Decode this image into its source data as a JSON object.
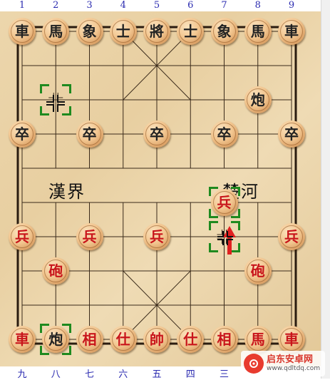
{
  "top_files": [
    "1",
    "2",
    "3",
    "4",
    "5",
    "6",
    "7",
    "8",
    "9"
  ],
  "bottom_files": [
    "九",
    "八",
    "七",
    "六",
    "五",
    "四",
    "三"
  ],
  "river": {
    "left": "漢界",
    "right": "楚河"
  },
  "pieces": [
    {
      "label": "車",
      "side": "black",
      "file": 0,
      "rank": 0
    },
    {
      "label": "馬",
      "side": "black",
      "file": 1,
      "rank": 0
    },
    {
      "label": "象",
      "side": "black",
      "file": 2,
      "rank": 0
    },
    {
      "label": "士",
      "side": "black",
      "file": 3,
      "rank": 0
    },
    {
      "label": "將",
      "side": "black",
      "file": 4,
      "rank": 0
    },
    {
      "label": "士",
      "side": "black",
      "file": 5,
      "rank": 0
    },
    {
      "label": "象",
      "side": "black",
      "file": 6,
      "rank": 0
    },
    {
      "label": "馬",
      "side": "black",
      "file": 7,
      "rank": 0
    },
    {
      "label": "車",
      "side": "black",
      "file": 8,
      "rank": 0
    },
    {
      "label": "炮",
      "side": "black",
      "file": 7,
      "rank": 2
    },
    {
      "label": "卒",
      "side": "black",
      "file": 0,
      "rank": 3
    },
    {
      "label": "卒",
      "side": "black",
      "file": 2,
      "rank": 3
    },
    {
      "label": "卒",
      "side": "black",
      "file": 4,
      "rank": 3
    },
    {
      "label": "卒",
      "side": "black",
      "file": 6,
      "rank": 3
    },
    {
      "label": "卒",
      "side": "black",
      "file": 8,
      "rank": 3
    },
    {
      "label": "兵",
      "side": "red",
      "file": 6,
      "rank": 5
    },
    {
      "label": "兵",
      "side": "red",
      "file": 0,
      "rank": 6
    },
    {
      "label": "兵",
      "side": "red",
      "file": 2,
      "rank": 6
    },
    {
      "label": "兵",
      "side": "red",
      "file": 4,
      "rank": 6
    },
    {
      "label": "兵",
      "side": "red",
      "file": 8,
      "rank": 6
    },
    {
      "label": "砲",
      "side": "red",
      "file": 1,
      "rank": 7
    },
    {
      "label": "砲",
      "side": "red",
      "file": 7,
      "rank": 7
    },
    {
      "label": "車",
      "side": "red",
      "file": 0,
      "rank": 9
    },
    {
      "label": "炮",
      "side": "black",
      "file": 1,
      "rank": 9
    },
    {
      "label": "相",
      "side": "red",
      "file": 2,
      "rank": 9
    },
    {
      "label": "仕",
      "side": "red",
      "file": 3,
      "rank": 9
    },
    {
      "label": "帥",
      "side": "red",
      "file": 4,
      "rank": 9
    },
    {
      "label": "仕",
      "side": "red",
      "file": 5,
      "rank": 9
    },
    {
      "label": "相",
      "side": "red",
      "file": 6,
      "rank": 9
    },
    {
      "label": "馬",
      "side": "red",
      "file": 7,
      "rank": 9
    },
    {
      "label": "車",
      "side": "red",
      "file": 8,
      "rank": 9
    }
  ],
  "markers": [
    {
      "file": 1,
      "rank": 2
    },
    {
      "file": 6,
      "rank": 5
    },
    {
      "file": 6,
      "rank": 6
    },
    {
      "file": 1,
      "rank": 9
    }
  ],
  "colors": {
    "board": "#ecd6ac",
    "red_piece_text": "#c8151b",
    "black_piece_text": "#222222",
    "marker": "#1f8a1f",
    "move_arrow": "#e02020",
    "file_numbers": "#2b2bb0"
  },
  "watermark": {
    "name": "启东安卓网",
    "url": "www.qdltdq.com"
  }
}
